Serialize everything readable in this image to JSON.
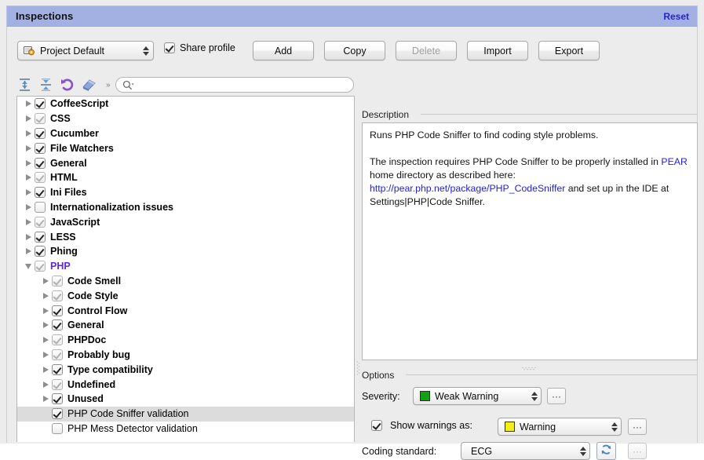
{
  "window": {
    "title": "Inspections",
    "reset_label": "Reset"
  },
  "toolbar": {
    "profile_value": "Project Default",
    "profile_icon": "profile-gear-icon",
    "share_label": "Share profile",
    "share_checked": true,
    "buttons": [
      {
        "label": "Add",
        "disabled": false
      },
      {
        "label": "Copy",
        "disabled": false
      },
      {
        "label": "Delete",
        "disabled": true
      },
      {
        "label": "Import",
        "disabled": false
      },
      {
        "label": "Export",
        "disabled": false
      }
    ]
  },
  "tree_toolbar": {
    "icons": [
      "expand-all-icon",
      "collapse-all-icon",
      "undo-icon",
      "eraser-icon"
    ],
    "overflow_label": "»",
    "search_value": "",
    "search_placeholder": ""
  },
  "tree": {
    "rows": [
      {
        "label": "CoffeeScript",
        "indent": 0,
        "twisty": "right",
        "check": "on",
        "bold": true,
        "accent": false,
        "selected": false
      },
      {
        "label": "CSS",
        "indent": 0,
        "twisty": "right",
        "check": "partial",
        "bold": true,
        "accent": false,
        "selected": false
      },
      {
        "label": "Cucumber",
        "indent": 0,
        "twisty": "right",
        "check": "on",
        "bold": true,
        "accent": false,
        "selected": false
      },
      {
        "label": "File Watchers",
        "indent": 0,
        "twisty": "right",
        "check": "on",
        "bold": true,
        "accent": false,
        "selected": false
      },
      {
        "label": "General",
        "indent": 0,
        "twisty": "right",
        "check": "on",
        "bold": true,
        "accent": false,
        "selected": false
      },
      {
        "label": "HTML",
        "indent": 0,
        "twisty": "right",
        "check": "partial",
        "bold": true,
        "accent": false,
        "selected": false
      },
      {
        "label": "Ini Files",
        "indent": 0,
        "twisty": "right",
        "check": "on",
        "bold": true,
        "accent": false,
        "selected": false
      },
      {
        "label": "Internationalization issues",
        "indent": 0,
        "twisty": "right",
        "check": "off",
        "bold": true,
        "accent": false,
        "selected": false
      },
      {
        "label": "JavaScript",
        "indent": 0,
        "twisty": "right",
        "check": "partial",
        "bold": true,
        "accent": false,
        "selected": false
      },
      {
        "label": "LESS",
        "indent": 0,
        "twisty": "right",
        "check": "on",
        "bold": true,
        "accent": false,
        "selected": false
      },
      {
        "label": "Phing",
        "indent": 0,
        "twisty": "right",
        "check": "on",
        "bold": true,
        "accent": false,
        "selected": false
      },
      {
        "label": "PHP",
        "indent": 0,
        "twisty": "down",
        "check": "partial",
        "bold": true,
        "accent": true,
        "selected": false
      },
      {
        "label": "Code Smell",
        "indent": 1,
        "twisty": "right",
        "check": "partial",
        "bold": true,
        "accent": false,
        "selected": false
      },
      {
        "label": "Code Style",
        "indent": 1,
        "twisty": "right",
        "check": "partial",
        "bold": true,
        "accent": false,
        "selected": false
      },
      {
        "label": "Control Flow",
        "indent": 1,
        "twisty": "right",
        "check": "on",
        "bold": true,
        "accent": false,
        "selected": false
      },
      {
        "label": "General",
        "indent": 1,
        "twisty": "right",
        "check": "on",
        "bold": true,
        "accent": false,
        "selected": false
      },
      {
        "label": "PHPDoc",
        "indent": 1,
        "twisty": "right",
        "check": "partial",
        "bold": true,
        "accent": false,
        "selected": false
      },
      {
        "label": "Probably bug",
        "indent": 1,
        "twisty": "right",
        "check": "partial",
        "bold": true,
        "accent": false,
        "selected": false
      },
      {
        "label": "Type compatibility",
        "indent": 1,
        "twisty": "right",
        "check": "on",
        "bold": true,
        "accent": false,
        "selected": false
      },
      {
        "label": "Undefined",
        "indent": 1,
        "twisty": "right",
        "check": "partial",
        "bold": true,
        "accent": false,
        "selected": false
      },
      {
        "label": "Unused",
        "indent": 1,
        "twisty": "right",
        "check": "on",
        "bold": true,
        "accent": false,
        "selected": false
      },
      {
        "label": "PHP Code Sniffer validation",
        "indent": 1,
        "twisty": "none",
        "check": "on",
        "bold": false,
        "accent": false,
        "selected": true
      },
      {
        "label": "PHP Mess Detector validation",
        "indent": 1,
        "twisty": "none",
        "check": "off",
        "bold": false,
        "accent": false,
        "selected": false
      }
    ]
  },
  "description": {
    "section_label": "Description",
    "paragraph1": "Runs PHP Code Sniffer to find coding style problems.",
    "p2_part1": "The inspection requires PHP Code Sniffer to be properly installed in ",
    "p2_link1": "PEAR",
    "p2_part2": " home directory as described here: ",
    "p2_link2": "http://pear.php.net/package/PHP_CodeSniffer",
    "p2_part3": " and set up in the IDE at Settings|PHP|Code Sniffer."
  },
  "options": {
    "section_label": "Options",
    "severity_label": "Severity:",
    "severity_value": "Weak Warning",
    "severity_color": "#12a112",
    "severity_more_label": "···",
    "show_warnings_checked": true,
    "show_warnings_label": "Show warnings as:",
    "show_warnings_value": "Warning",
    "show_warnings_color": "#f2ef14",
    "show_warnings_more_label": "···",
    "coding_standard_label": "Coding standard:",
    "coding_standard_value": "ECG",
    "refresh_icon": "refresh-icon",
    "coding_standard_more_label": "···"
  }
}
